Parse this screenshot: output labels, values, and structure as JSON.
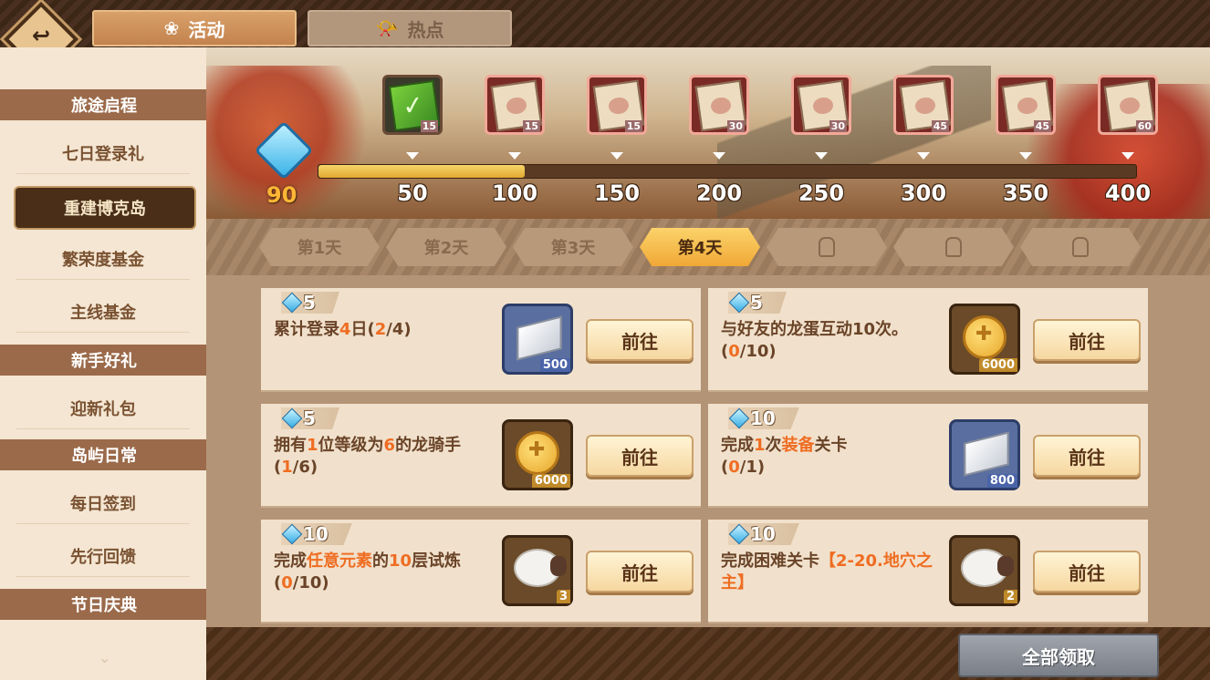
{
  "tabs": [
    {
      "label": "活动",
      "active": true
    },
    {
      "label": "热点",
      "active": false
    }
  ],
  "sidebar": {
    "groups": [
      {
        "header": "旅途启程",
        "items": [
          "七日登录礼",
          "重建博克岛",
          "繁荣度基金",
          "主线基金"
        ]
      },
      {
        "header": "新手好礼",
        "items": [
          "迎新礼包"
        ]
      },
      {
        "header": "岛屿日常",
        "items": [
          "每日签到",
          "先行回馈"
        ]
      },
      {
        "header": "节日庆典",
        "items": []
      }
    ],
    "selected": "重建博克岛"
  },
  "progress": {
    "current": "90",
    "current_value": 90,
    "max_value": 400,
    "milestones": [
      {
        "label": "50",
        "reward_count": "15",
        "claimed": true
      },
      {
        "label": "100",
        "reward_count": "15",
        "claimed": false
      },
      {
        "label": "150",
        "reward_count": "15",
        "claimed": false
      },
      {
        "label": "200",
        "reward_count": "30",
        "claimed": false
      },
      {
        "label": "250",
        "reward_count": "30",
        "claimed": false
      },
      {
        "label": "300",
        "reward_count": "45",
        "claimed": false
      },
      {
        "label": "350",
        "reward_count": "45",
        "claimed": false
      },
      {
        "label": "400",
        "reward_count": "60",
        "claimed": false
      }
    ]
  },
  "days": [
    {
      "label": "第1天",
      "state": "past"
    },
    {
      "label": "第2天",
      "state": "past"
    },
    {
      "label": "第3天",
      "state": "past"
    },
    {
      "label": "第4天",
      "state": "active"
    },
    {
      "label": "",
      "state": "locked"
    },
    {
      "label": "",
      "state": "locked"
    },
    {
      "label": "",
      "state": "locked"
    }
  ],
  "tasks": [
    {
      "points": "5",
      "desc_parts": [
        [
          "累计登录",
          false
        ],
        [
          "4",
          true
        ],
        [
          "日(",
          false
        ],
        [
          "2",
          true
        ],
        [
          "/4)",
          false
        ]
      ],
      "item": "ingot",
      "item_count": "500",
      "button": "前往"
    },
    {
      "points": "5",
      "desc_parts": [
        [
          "与好友的龙蛋互动10次。",
          false
        ],
        [
          "(",
          false
        ],
        [
          "0",
          true
        ],
        [
          "/10)",
          false
        ]
      ],
      "item": "coin",
      "item_count": "6000",
      "button": "前往"
    },
    {
      "points": "5",
      "desc_parts": [
        [
          "拥有",
          false
        ],
        [
          "1",
          true
        ],
        [
          "位等级为",
          false
        ],
        [
          "6",
          true
        ],
        [
          "的龙骑手",
          false
        ],
        [
          "(",
          false
        ],
        [
          "1",
          true
        ],
        [
          "/6)",
          false
        ]
      ],
      "item": "coin",
      "item_count": "6000",
      "button": "前往"
    },
    {
      "points": "10",
      "desc_parts": [
        [
          "完成",
          false
        ],
        [
          "1",
          true
        ],
        [
          "次",
          false
        ],
        [
          "装备",
          true
        ],
        [
          "关卡",
          false
        ],
        [
          "(",
          false
        ],
        [
          "0",
          true
        ],
        [
          "/1)",
          false
        ]
      ],
      "item": "ingot",
      "item_count": "800",
      "button": "前往"
    },
    {
      "points": "10",
      "desc_parts": [
        [
          "完成",
          false
        ],
        [
          "任意元素",
          true
        ],
        [
          "的",
          false
        ],
        [
          "10",
          true
        ],
        [
          "层试炼",
          false
        ],
        [
          "(",
          false
        ],
        [
          "0",
          true
        ],
        [
          "/10)",
          false
        ]
      ],
      "item": "sheep",
      "item_count": "3",
      "button": "前往"
    },
    {
      "points": "10",
      "desc_parts": [
        [
          "完成困难关卡",
          false
        ],
        [
          "【2-20.地穴之主】",
          true
        ]
      ],
      "item": "sheep",
      "item_count": "2",
      "button": "前往"
    }
  ],
  "footer": {
    "claim_all": "全部领取"
  },
  "colors": {
    "accent": "#ef6d22",
    "brown": "#4a2e18",
    "cream": "#f1e1cc",
    "gold": "#f0a836"
  }
}
